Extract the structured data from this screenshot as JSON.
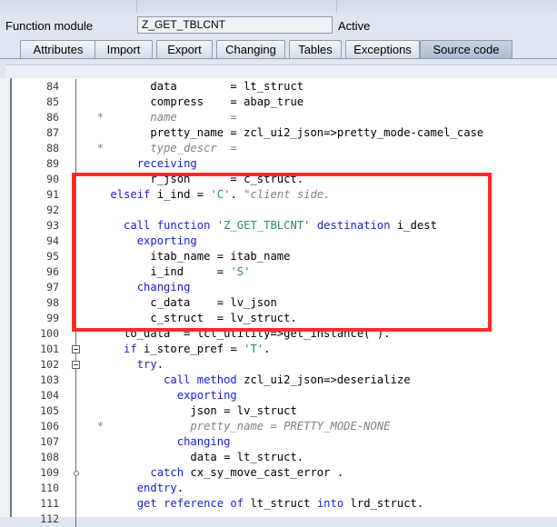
{
  "header": {
    "label": "Function module",
    "name_value": "Z_GET_TBLCNT",
    "status": "Active"
  },
  "tabs": [
    {
      "label": "Attributes",
      "active": false
    },
    {
      "label": "Import",
      "active": false
    },
    {
      "label": "Export",
      "active": false
    },
    {
      "label": "Changing",
      "active": false
    },
    {
      "label": "Tables",
      "active": false
    },
    {
      "label": "Exceptions",
      "active": false
    },
    {
      "label": "Source code",
      "active": true
    }
  ],
  "editor": {
    "lines": [
      {
        "num": "84",
        "fold": "line",
        "tokens": [
          {
            "t": "          data        = lt_struct",
            "c": ""
          }
        ]
      },
      {
        "num": "85",
        "fold": "line",
        "tokens": [
          {
            "t": "          compress    = abap_true",
            "c": ""
          }
        ]
      },
      {
        "num": "86",
        "fold": "line",
        "tokens": [
          {
            "t": "  *       name        =",
            "c": "cm"
          }
        ]
      },
      {
        "num": "87",
        "fold": "line",
        "tokens": [
          {
            "t": "          pretty_name = zcl_ui2_json=>pretty_mode-camel_case",
            "c": ""
          }
        ]
      },
      {
        "num": "88",
        "fold": "line",
        "tokens": [
          {
            "t": "  *       type_descr  =",
            "c": "cm"
          }
        ]
      },
      {
        "num": "89",
        "fold": "line",
        "tokens": [
          {
            "t": "        ",
            "c": ""
          },
          {
            "t": "receiving",
            "c": "kw"
          }
        ]
      },
      {
        "num": "90",
        "fold": "line",
        "tokens": [
          {
            "t": "          r_json      = c_struct.",
            "c": ""
          }
        ]
      },
      {
        "num": "91",
        "fold": "line",
        "tokens": [
          {
            "t": "    ",
            "c": ""
          },
          {
            "t": "elseif",
            "c": "kw"
          },
          {
            "t": " i_ind = ",
            "c": ""
          },
          {
            "t": "'C'",
            "c": "str"
          },
          {
            "t": ". ",
            "c": ""
          },
          {
            "t": "\"client side.",
            "c": "cm"
          }
        ]
      },
      {
        "num": "92",
        "fold": "line",
        "tokens": [
          {
            "t": "",
            "c": ""
          }
        ]
      },
      {
        "num": "93",
        "fold": "line",
        "tokens": [
          {
            "t": "      ",
            "c": ""
          },
          {
            "t": "call function",
            "c": "kw"
          },
          {
            "t": " ",
            "c": ""
          },
          {
            "t": "'Z_GET_TBLCNT'",
            "c": "str"
          },
          {
            "t": " ",
            "c": ""
          },
          {
            "t": "destination",
            "c": "kw"
          },
          {
            "t": " i_dest",
            "c": ""
          }
        ]
      },
      {
        "num": "94",
        "fold": "line",
        "tokens": [
          {
            "t": "        ",
            "c": ""
          },
          {
            "t": "exporting",
            "c": "kw"
          }
        ]
      },
      {
        "num": "95",
        "fold": "line",
        "tokens": [
          {
            "t": "          itab_name = itab_name",
            "c": ""
          }
        ]
      },
      {
        "num": "96",
        "fold": "line",
        "tokens": [
          {
            "t": "          i_ind     = ",
            "c": ""
          },
          {
            "t": "'S'",
            "c": "str"
          }
        ]
      },
      {
        "num": "97",
        "fold": "line",
        "tokens": [
          {
            "t": "        ",
            "c": ""
          },
          {
            "t": "changing",
            "c": "kw"
          }
        ]
      },
      {
        "num": "98",
        "fold": "line",
        "tokens": [
          {
            "t": "          c_data    = lv_json",
            "c": ""
          }
        ]
      },
      {
        "num": "99",
        "fold": "line",
        "tokens": [
          {
            "t": "          c_struct  = lv_struct.",
            "c": ""
          }
        ]
      },
      {
        "num": "100",
        "fold": "line",
        "tokens": [
          {
            "t": "      lo_data  = lcl_utility=>get_instance( ).",
            "c": ""
          }
        ]
      },
      {
        "num": "101",
        "fold": "box",
        "tokens": [
          {
            "t": "      ",
            "c": ""
          },
          {
            "t": "if",
            "c": "kw"
          },
          {
            "t": " i_store_pref = ",
            "c": ""
          },
          {
            "t": "'T'",
            "c": "str"
          },
          {
            "t": ".",
            "c": ""
          }
        ]
      },
      {
        "num": "102",
        "fold": "box",
        "tokens": [
          {
            "t": "        ",
            "c": ""
          },
          {
            "t": "try",
            "c": "kw"
          },
          {
            "t": ".",
            "c": ""
          }
        ]
      },
      {
        "num": "103",
        "fold": "line",
        "tokens": [
          {
            "t": "            ",
            "c": ""
          },
          {
            "t": "call method",
            "c": "kw"
          },
          {
            "t": " zcl_ui2_json=>deserialize",
            "c": ""
          }
        ]
      },
      {
        "num": "104",
        "fold": "line",
        "tokens": [
          {
            "t": "              ",
            "c": ""
          },
          {
            "t": "exporting",
            "c": "kw"
          }
        ]
      },
      {
        "num": "105",
        "fold": "line",
        "tokens": [
          {
            "t": "                json = lv_struct",
            "c": ""
          }
        ]
      },
      {
        "num": "106",
        "fold": "line",
        "tokens": [
          {
            "t": "  *             pretty_name = PRETTY_MODE-NONE",
            "c": "cm"
          }
        ]
      },
      {
        "num": "107",
        "fold": "line",
        "tokens": [
          {
            "t": "              ",
            "c": ""
          },
          {
            "t": "changing",
            "c": "kw"
          }
        ]
      },
      {
        "num": "108",
        "fold": "line",
        "tokens": [
          {
            "t": "                data = lt_struct.",
            "c": ""
          }
        ]
      },
      {
        "num": "109",
        "fold": "dot",
        "tokens": [
          {
            "t": "          ",
            "c": ""
          },
          {
            "t": "catch",
            "c": "kw"
          },
          {
            "t": " cx_sy_move_cast_error .",
            "c": ""
          }
        ]
      },
      {
        "num": "110",
        "fold": "line",
        "tokens": [
          {
            "t": "        ",
            "c": ""
          },
          {
            "t": "endtry",
            "c": "kw"
          },
          {
            "t": ".",
            "c": ""
          }
        ]
      },
      {
        "num": "111",
        "fold": "line",
        "tokens": [
          {
            "t": "        ",
            "c": ""
          },
          {
            "t": "get reference of",
            "c": "kw"
          },
          {
            "t": " lt_struct ",
            "c": ""
          },
          {
            "t": "into",
            "c": "kw"
          },
          {
            "t": " lrd_struct.",
            "c": ""
          }
        ]
      },
      {
        "num": "112",
        "fold": "line",
        "tokens": [
          {
            "t": "",
            "c": ""
          }
        ]
      }
    ]
  },
  "colors": {
    "keyword": "#1c1cc8",
    "string": "#2e8b57",
    "comment": "#808080",
    "highlight_box": "#ff2b2b"
  }
}
